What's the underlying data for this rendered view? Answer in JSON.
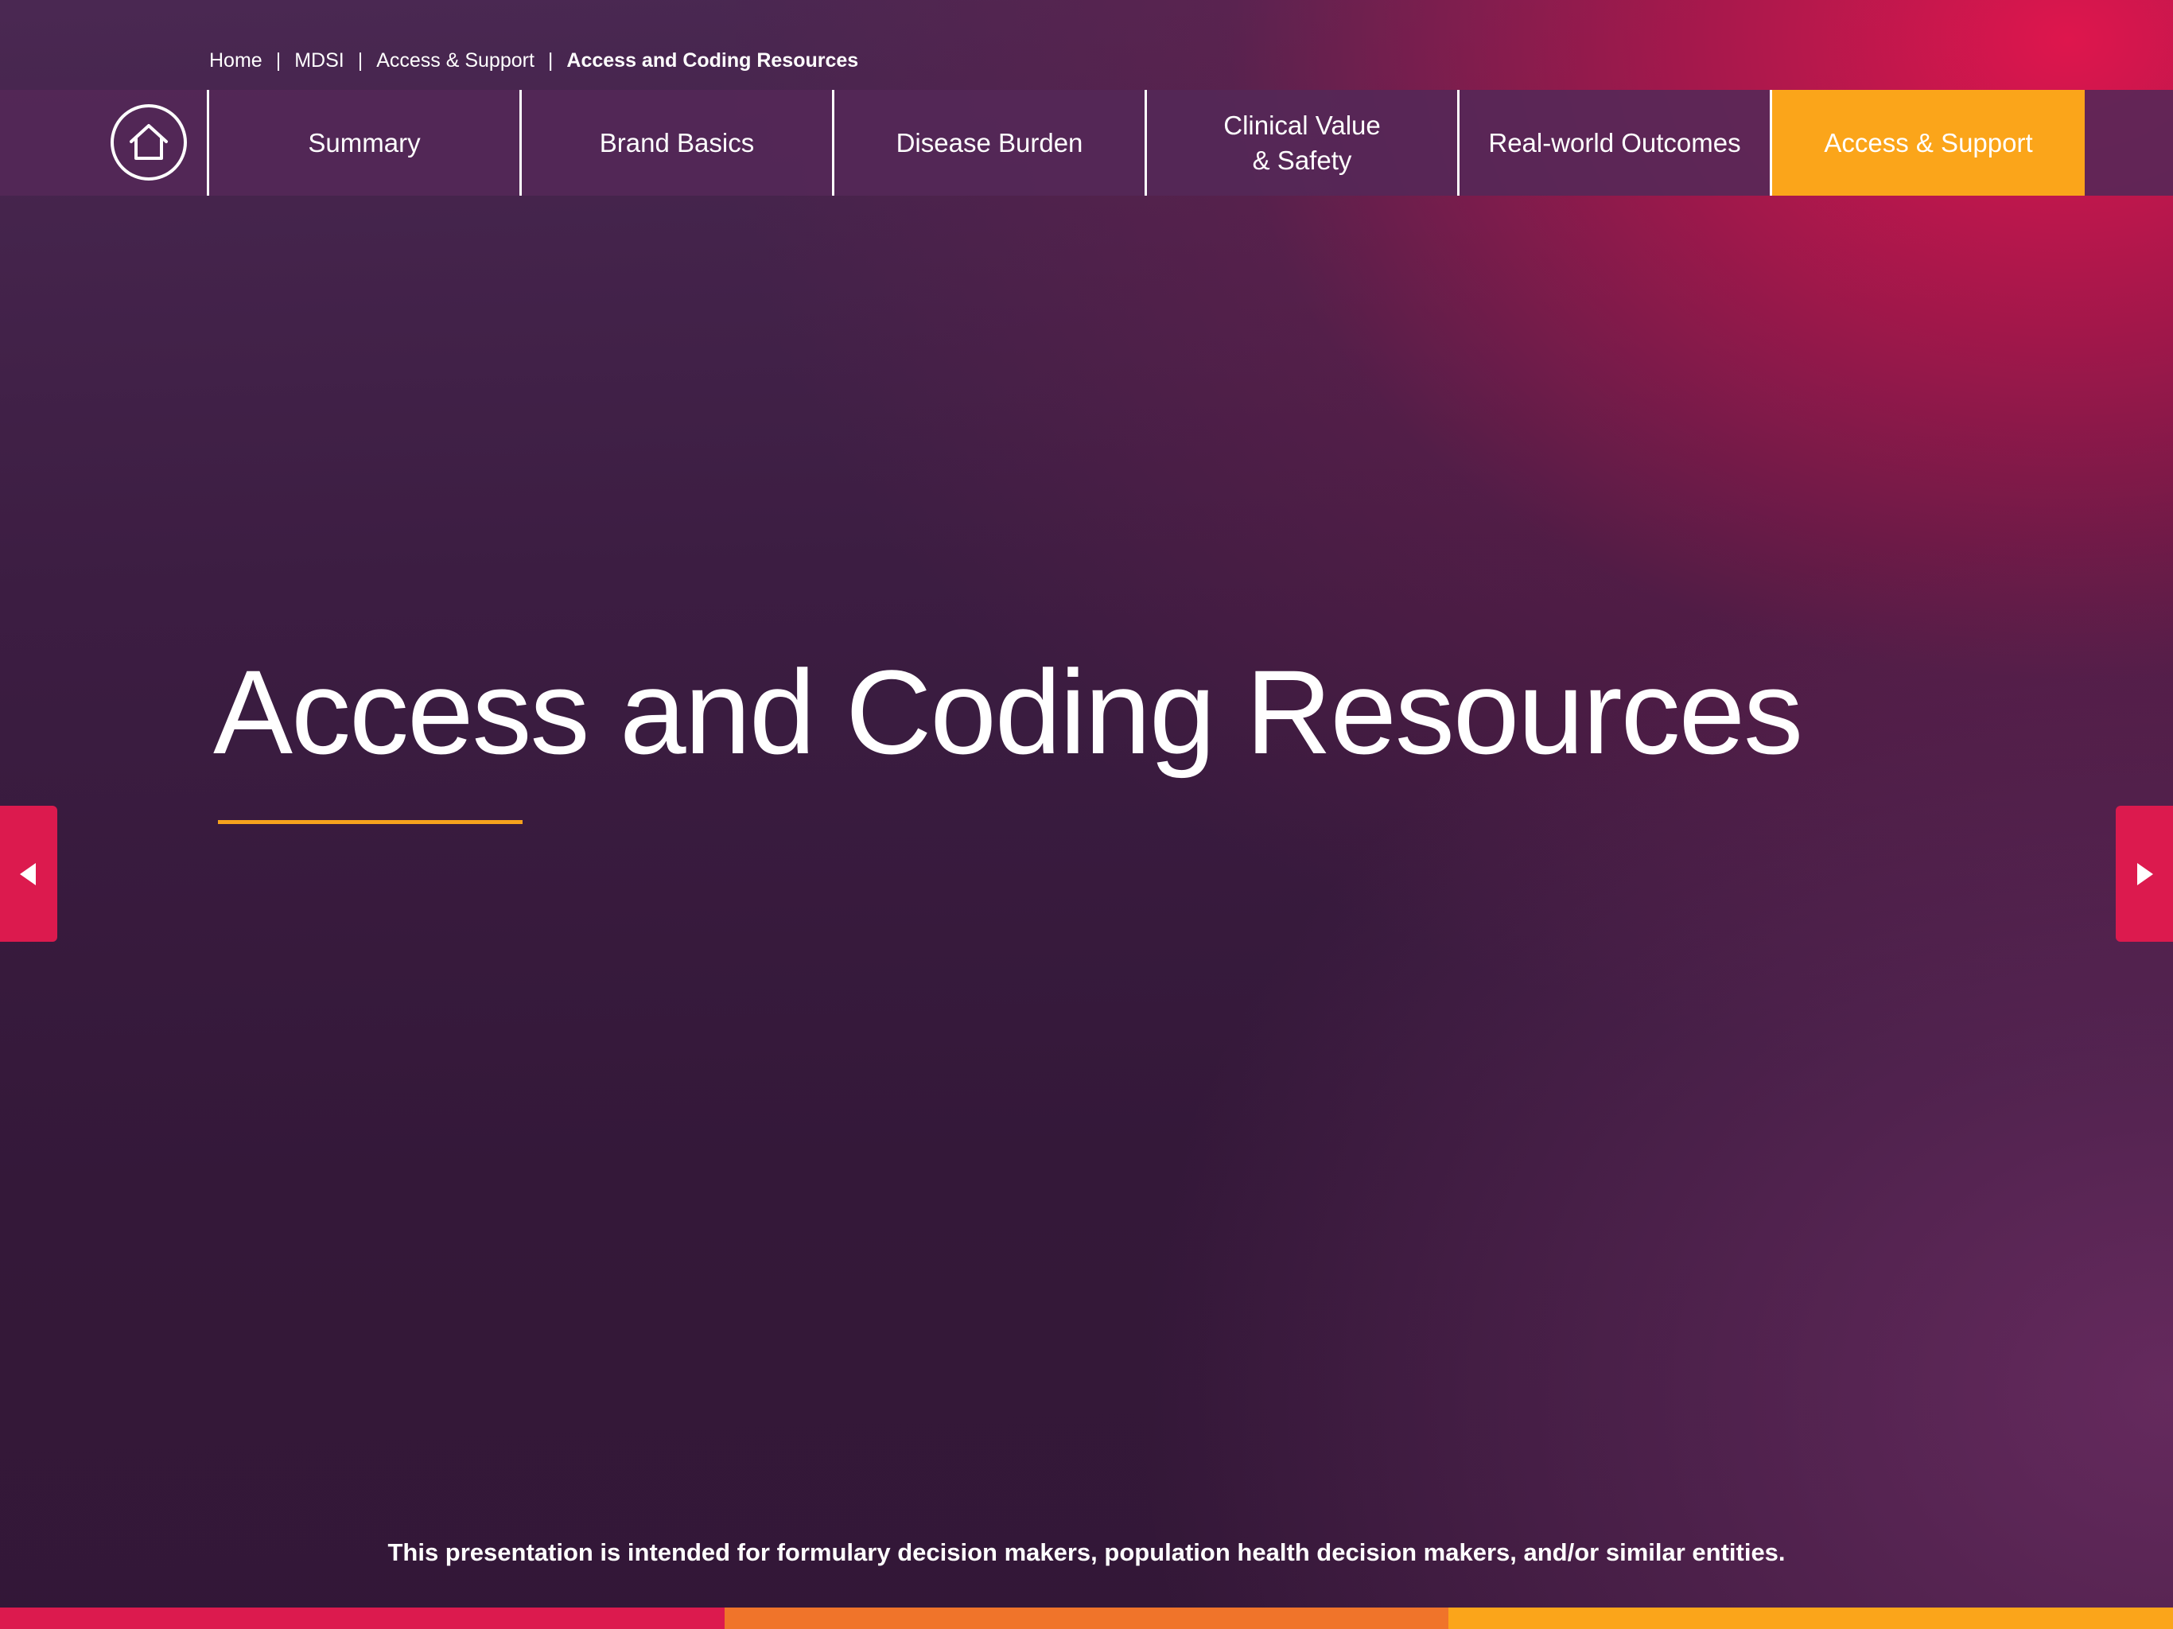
{
  "breadcrumb": {
    "items": [
      "Home",
      "MDSI",
      "Access & Support",
      "Access and Coding Resources"
    ],
    "separator": "|"
  },
  "nav": {
    "home_icon": "home-icon",
    "items": [
      {
        "label": "Summary"
      },
      {
        "label": "Brand Basics"
      },
      {
        "label": "Disease Burden"
      },
      {
        "label": "Clinical Value\n& Safety"
      },
      {
        "label": "Real-world Outcomes"
      },
      {
        "label": "Access & Support",
        "active": true
      }
    ]
  },
  "main": {
    "title": "Access and Coding Resources"
  },
  "arrows": {
    "prev_icon": "triangle-left-icon",
    "next_icon": "triangle-right-icon"
  },
  "footer": {
    "disclaimer": "This presentation is intended for formulary decision makers, population health decision makers, and/or similar entities."
  },
  "colors": {
    "accent_orange": "#fba51a",
    "accent_red": "#dc1a4e",
    "strip": [
      "#dc1a4e",
      "#f0742a",
      "#fba51a"
    ]
  }
}
